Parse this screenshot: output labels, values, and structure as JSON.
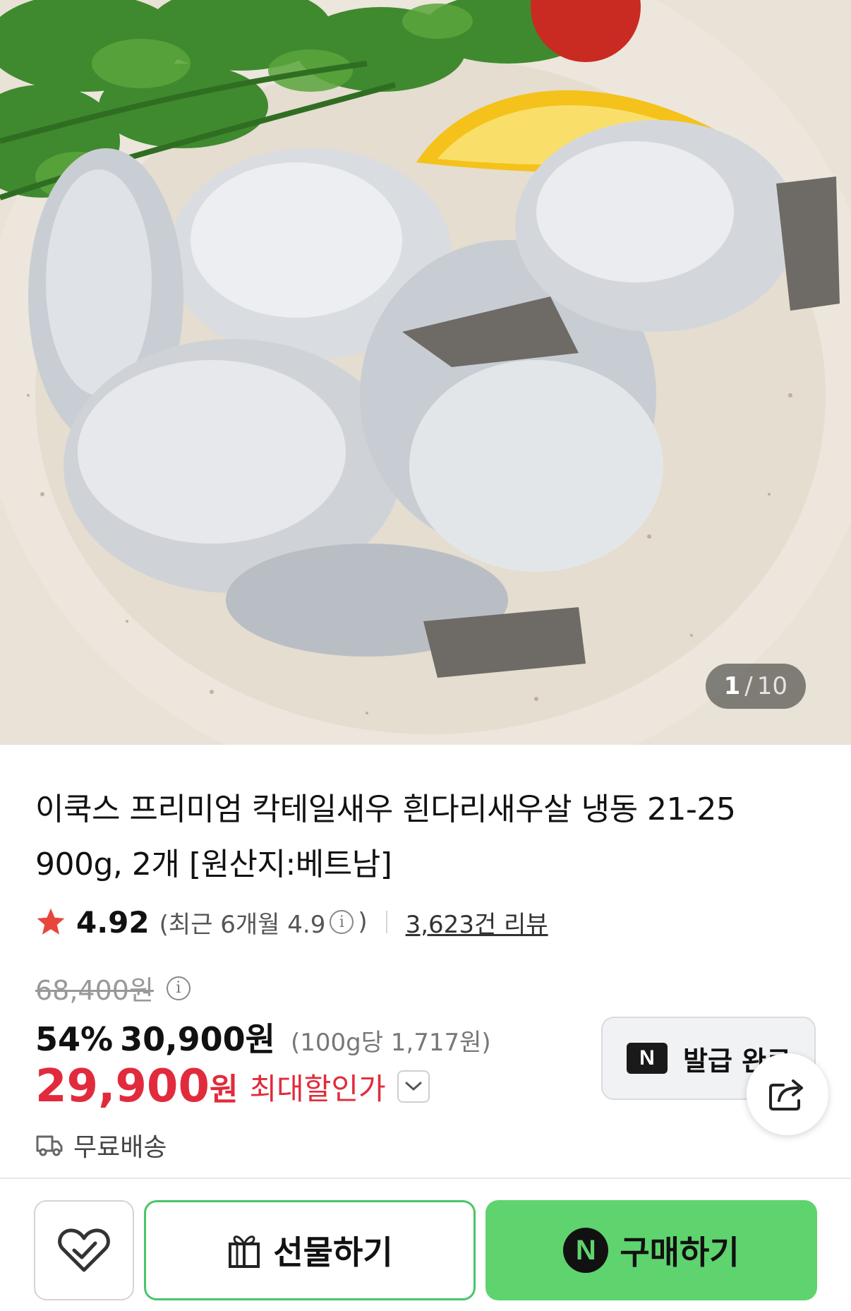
{
  "gallery": {
    "current": "1",
    "separator": "/",
    "total": "10",
    "image_description_icon": "product-photo"
  },
  "product": {
    "title_line1": "이쿡스 프리미엄 칵테일새우 흰다리새우살 냉동 21-25",
    "title_line2": "900g, 2개 [원산지:베트남]"
  },
  "rating": {
    "score": "4.92",
    "recent_prefix": "(최근 6개월 4.9",
    "recent_suffix": ")",
    "info_glyph": "i",
    "reviews": "3,623건 리뷰",
    "star_color": "#e8453c"
  },
  "price": {
    "original": "68,400원",
    "discount_rate": "54%",
    "sale_price": "30,900원",
    "unit_price": "(100g당 1,717원)",
    "best_price": "29,900",
    "best_won": "원",
    "best_label": "최대할인가",
    "accent_color": "#e12b3c"
  },
  "coupon": {
    "badge": "N",
    "label": "발급 완료"
  },
  "shipping": {
    "label": "무료배송"
  },
  "bottom_bar": {
    "gift_label": "선물하기",
    "buy_badge": "N",
    "buy_label": "구매하기",
    "buy_color": "#5fd36e",
    "gift_border_color": "#49c56a"
  }
}
